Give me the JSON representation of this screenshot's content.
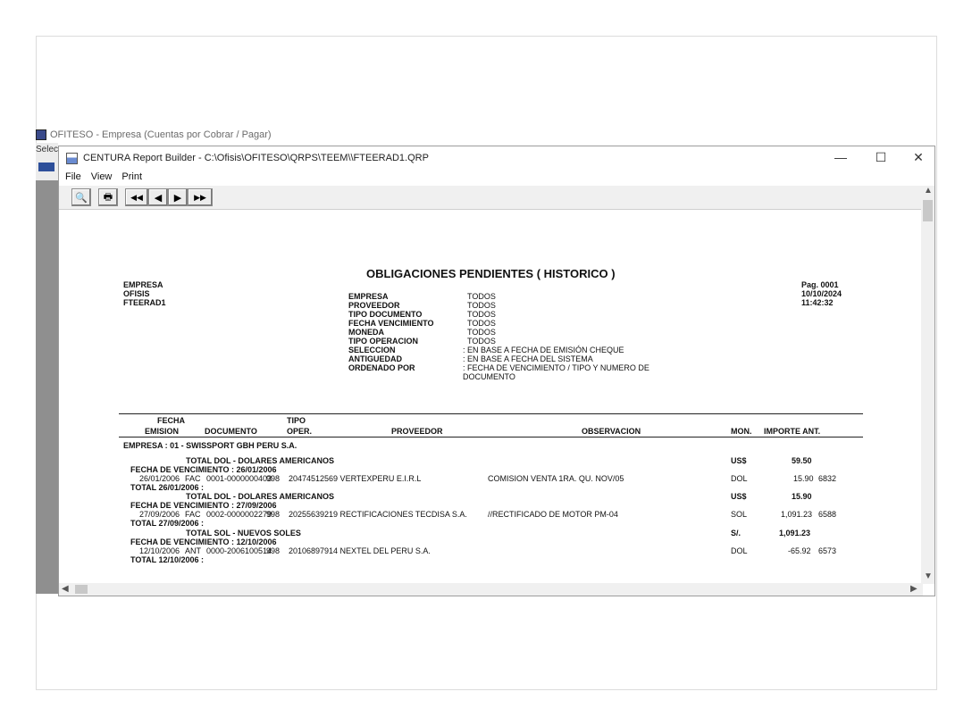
{
  "background_window": {
    "title": "OFITESO - Empresa (Cuentas por Cobrar / Pagar)",
    "menu_fragment": "Selec"
  },
  "window": {
    "title": "CENTURA Report Builder - C:\\Ofisis\\OFITESO\\QRPS\\TEEM\\\\FTEERAD1.QRP",
    "controls": {
      "minimize": "—",
      "maximize": "☐",
      "close": "✕"
    },
    "menu": [
      "File",
      "View",
      "Print"
    ]
  },
  "toolbar": {
    "preview_icon": "🔍",
    "print_icon": "🖶",
    "first": "◀◀",
    "prev": "◀",
    "next": "▶",
    "last": "▶▶"
  },
  "report": {
    "left_header": [
      "EMPRESA",
      "OFISIS",
      "FTEERAD1"
    ],
    "title": "OBLIGACIONES PENDIENTES ( HISTORICO )",
    "right_header": [
      "Pag.  0001",
      "10/10/2024",
      "11:42:32"
    ],
    "filters": [
      {
        "label": "EMPRESA",
        "value": "TODOS"
      },
      {
        "label": "PROVEEDOR",
        "value": "TODOS"
      },
      {
        "label": "TIPO DOCUMENTO",
        "value": "TODOS"
      },
      {
        "label": "FECHA VENCIMIENTO",
        "value": "TODOS"
      },
      {
        "label": "MONEDA",
        "value": "TODOS"
      },
      {
        "label": "TIPO OPERACION",
        "value": "TODOS"
      },
      {
        "label": "SELECCION",
        "value": ": EN BASE A FECHA DE EMISIÓN  CHEQUE"
      },
      {
        "label": "ANTIGUEDAD",
        "value": ": EN BASE A FECHA DEL SISTEMA"
      },
      {
        "label": "ORDENADO POR",
        "value": ": FECHA DE VENCIMIENTO / TIPO Y NUMERO DE"
      },
      {
        "label": "",
        "value": "  DOCUMENTO"
      }
    ],
    "columns": {
      "fecha_top": "FECHA",
      "emision": "EMISION",
      "documento": "DOCUMENTO",
      "tipo_top": "TIPO",
      "oper": "OPER.",
      "proveedor": "PROVEEDOR",
      "observacion": "OBSERVACION",
      "mon": "MON.",
      "importe": "IMPORTE  ANT."
    },
    "empresa_line": "EMPRESA : 01 - SWISSPORT GBH PERU S.A.",
    "groups": [
      {
        "total_label": "TOTAL DOL - DOLARES AMERICANOS",
        "total_mon": "US$",
        "total_amount": "59.50",
        "venc": "FECHA DE VENCIMIENTO : 26/01/2006",
        "row": {
          "emision": "26/01/2006",
          "tipo": "FAC",
          "documento": "0001-0000000403",
          "oper": "998",
          "proveedor": "20474512569  VERTEXPERU E.I.R.L",
          "observacion": "COMISION VENTA  1RA. QU. NOV/05",
          "mon": "DOL",
          "importe": "15.90",
          "ant": "6832"
        },
        "date_total": "TOTAL 26/01/2006 :"
      },
      {
        "total_label": "TOTAL DOL - DOLARES AMERICANOS",
        "total_mon": "US$",
        "total_amount": "15.90",
        "venc": "FECHA DE VENCIMIENTO : 27/09/2006",
        "row": {
          "emision": "27/09/2006",
          "tipo": "FAC",
          "documento": "0002-0000002279",
          "oper": "998",
          "proveedor": "20255639219  RECTIFICACIONES TECDISA S.A.",
          "observacion": "//RECTIFICADO DE MOTOR PM-04",
          "mon": "SOL",
          "importe": "1,091.23",
          "ant": "6588"
        },
        "date_total": "TOTAL 27/09/2006 :"
      },
      {
        "total_label": "TOTAL SOL - NUEVOS SOLES",
        "total_mon": "S/.",
        "total_amount": "1,091.23",
        "venc": "FECHA DE VENCIMIENTO : 12/10/2006",
        "row": {
          "emision": "12/10/2006",
          "tipo": "ANT",
          "documento": "0000-2006100514",
          "oper": "998",
          "proveedor": "20106897914  NEXTEL DEL PERU S.A.",
          "observacion": "",
          "mon": "DOL",
          "importe": "-65.92",
          "ant": "6573"
        },
        "date_total": "TOTAL 12/10/2006 :"
      }
    ]
  }
}
